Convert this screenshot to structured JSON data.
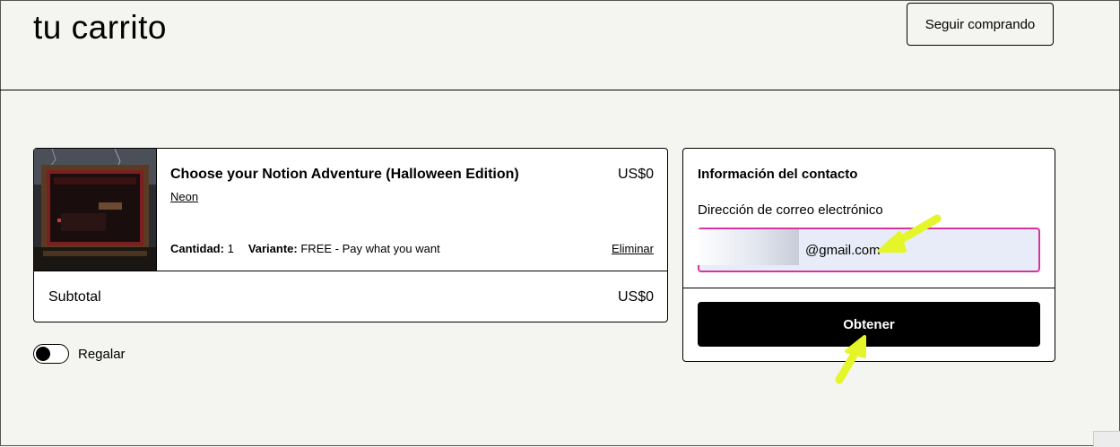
{
  "header": {
    "title": "tu carrito",
    "continue_label": "Seguir comprando"
  },
  "cart": {
    "item": {
      "title": "Choose your Notion Adventure (Halloween Edition)",
      "price": "US$0",
      "seller": "Neon",
      "quantity_label": "Cantidad:",
      "quantity_value": "1",
      "variant_label": "Variante:",
      "variant_value": "FREE - Pay what you want",
      "remove_label": "Eliminar"
    },
    "subtotal_label": "Subtotal",
    "subtotal_value": "US$0"
  },
  "gift": {
    "label": "Regalar",
    "enabled": false
  },
  "contact": {
    "title": "Información del contacto",
    "email_label": "Dirección de correo electrónico",
    "email_value": "@gmail.com",
    "submit_label": "Obtener"
  },
  "colors": {
    "background": "#f4f4f0",
    "input_border": "#d6349c",
    "input_fill": "#e8ecf8",
    "annotation_arrow": "#e4f52a"
  },
  "icons": {
    "annotation": "arrow-icon",
    "recaptcha": "recaptcha-icon"
  }
}
